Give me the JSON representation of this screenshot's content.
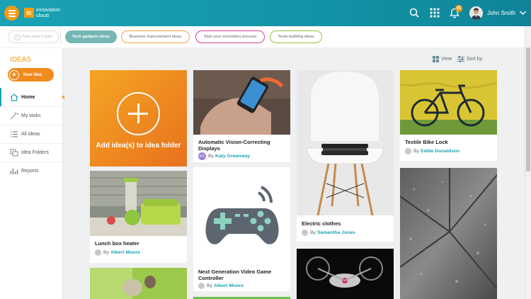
{
  "header": {
    "logo_mark": "ic",
    "logo_line1": "innovation",
    "logo_line2": "cloud",
    "notification_count": "41",
    "user_name": "John Smith"
  },
  "tabs": [
    {
      "label": "New Idea Folder"
    },
    {
      "label": "Tech gadgets ideas"
    },
    {
      "label": "Business improvement ideas"
    },
    {
      "label": "Start your innovation process"
    },
    {
      "label": "Team-building ideas"
    }
  ],
  "sidebar": {
    "title": "IDEAS",
    "new_idea_label": "New idea",
    "items": [
      {
        "label": "Home"
      },
      {
        "label": "My tasks"
      },
      {
        "label": "All ideas"
      },
      {
        "label": "Idea Folders"
      },
      {
        "label": "Reports"
      }
    ]
  },
  "toolbar": {
    "view_label": "View",
    "sort_label": "Sort by"
  },
  "add_card": {
    "label": "Add idea(s) to idea folder"
  },
  "cards": [
    {
      "title": "Automatic Vision-Correcting Displays",
      "by": "By",
      "author": "Katy Greenway",
      "initials": "KG"
    },
    {
      "title": "Lunch box heater",
      "by": "By",
      "author": "Albert Moore"
    },
    {
      "title": "Next Generation Video Game Controller",
      "by": "By",
      "author": "Albert Moore"
    },
    {
      "title": "Electric clothes",
      "by": "By",
      "author": "Samantha Jones"
    },
    {
      "title": "Textile Bike Lock",
      "by": "By",
      "author": "Eddie Donaldson"
    }
  ],
  "colors": {
    "brand_teal": "#1aa2b4",
    "accent_orange": "#f39c12",
    "active_tab": "#76b7b5"
  }
}
